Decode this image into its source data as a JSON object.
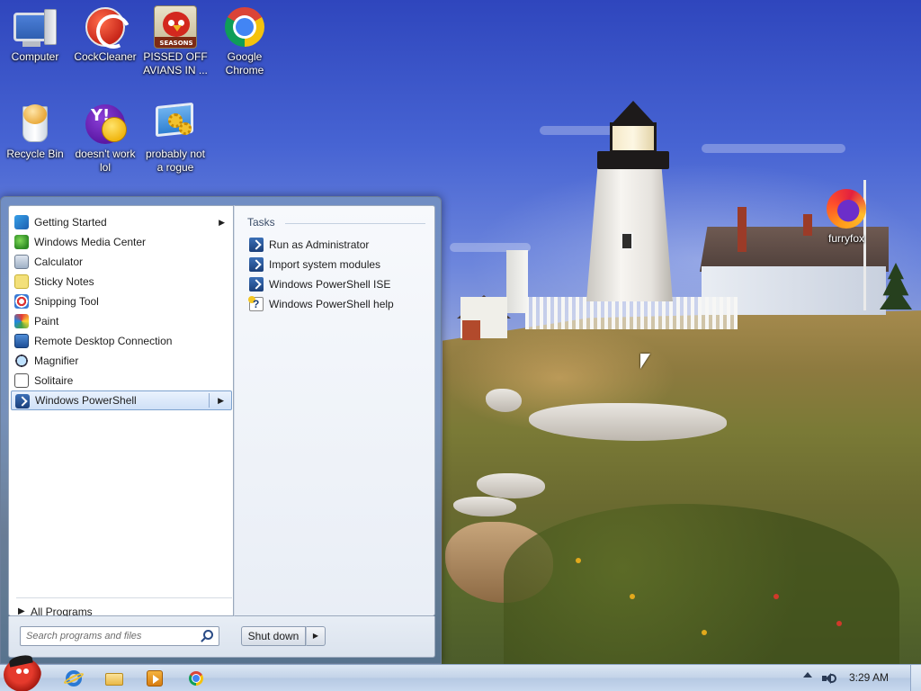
{
  "desktop": {
    "icons": [
      {
        "label": "Computer",
        "icon": "computer-icon"
      },
      {
        "label": "CockCleaner",
        "icon": "cleaner-icon"
      },
      {
        "label": "PISSED OFF AVIANS IN ...",
        "icon": "angry-bird-game-icon"
      },
      {
        "label": "Google Chrome",
        "icon": "chrome-icon"
      },
      {
        "label": "Recycle Bin",
        "icon": "recycle-bin-icon"
      },
      {
        "label": "doesn't work lol",
        "icon": "yahoo-messenger-icon"
      },
      {
        "label": "probably not a rogue",
        "icon": "gears-monitor-icon"
      },
      {
        "label": "furryfox",
        "icon": "firefox-icon"
      }
    ],
    "angry_bird_badge": "SEASONS"
  },
  "start_menu": {
    "programs": [
      {
        "label": "Getting Started",
        "has_submenu": true,
        "selected": false
      },
      {
        "label": "Windows Media Center",
        "has_submenu": false,
        "selected": false
      },
      {
        "label": "Calculator",
        "has_submenu": false,
        "selected": false
      },
      {
        "label": "Sticky Notes",
        "has_submenu": false,
        "selected": false
      },
      {
        "label": "Snipping Tool",
        "has_submenu": false,
        "selected": false
      },
      {
        "label": "Paint",
        "has_submenu": false,
        "selected": false
      },
      {
        "label": "Remote Desktop Connection",
        "has_submenu": false,
        "selected": false
      },
      {
        "label": "Magnifier",
        "has_submenu": false,
        "selected": false
      },
      {
        "label": "Solitaire",
        "has_submenu": false,
        "selected": false
      },
      {
        "label": "Windows PowerShell",
        "has_submenu": true,
        "selected": true
      }
    ],
    "all_programs": "All Programs",
    "tasks_header": "Tasks",
    "tasks": [
      {
        "label": "Run as Administrator",
        "icon": "powershell-icon"
      },
      {
        "label": "Import system modules",
        "icon": "powershell-icon"
      },
      {
        "label": "Windows PowerShell ISE",
        "icon": "powershell-icon"
      },
      {
        "label": "Windows PowerShell help",
        "icon": "help-icon"
      }
    ],
    "search_placeholder": "Search programs and files",
    "shutdown_label": "Shut down",
    "submenu_arrow": "▶"
  },
  "taskbar": {
    "pinned": [
      "internet-explorer-icon",
      "windows-explorer-icon",
      "media-player-icon",
      "chrome-icon"
    ],
    "clock": "3:29 AM"
  }
}
